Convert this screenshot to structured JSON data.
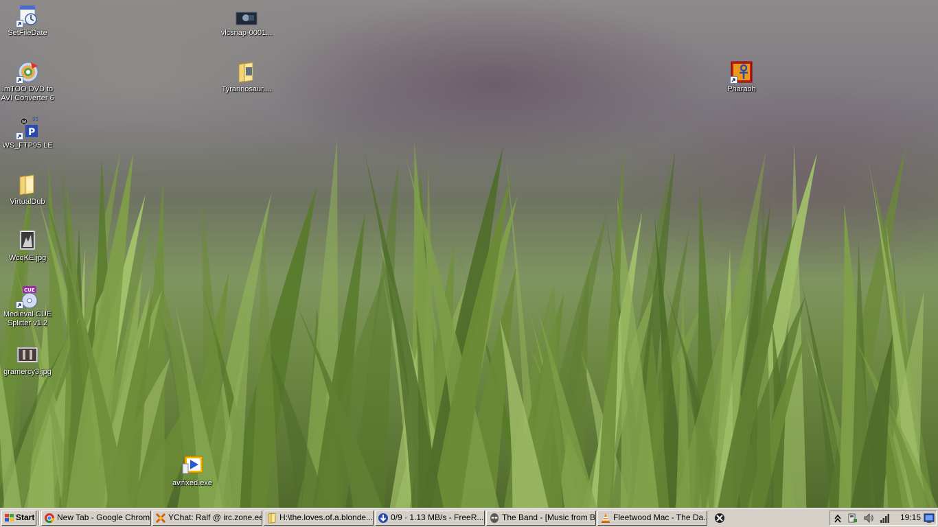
{
  "desktop": {
    "icons": [
      {
        "id": "setfiledate",
        "label": "SetFileDate",
        "icon": "calendar-clock-icon"
      },
      {
        "id": "imtoo",
        "label": "ImTOO DVD to AVI Converter 6",
        "icon": "dvd-converter-icon"
      },
      {
        "id": "wsftp",
        "label": "WS_FTP95 LE",
        "icon": "ftp-client-icon"
      },
      {
        "id": "virtualdub",
        "label": "VirtualDub",
        "icon": "folder-icon"
      },
      {
        "id": "wcqke",
        "label": "WcqKE.jpg",
        "icon": "image-file-icon"
      },
      {
        "id": "cuesplitter",
        "label": "Medieval CUE Splitter v1.2",
        "icon": "cue-splitter-icon"
      },
      {
        "id": "gramercy",
        "label": "gramercy3.jpg",
        "icon": "image-file-icon"
      },
      {
        "id": "avifixed",
        "label": "avifixed.exe",
        "icon": "media-exe-icon"
      },
      {
        "id": "vlcsnap",
        "label": "vlcsnap-0001...",
        "icon": "image-file-icon"
      },
      {
        "id": "tyrannosaur",
        "label": "Tyrannosaur....",
        "icon": "folder-icon"
      },
      {
        "id": "pharaoh",
        "label": "Pharaoh",
        "icon": "pharaoh-ankh-icon"
      }
    ]
  },
  "taskbar": {
    "start_label": "Start",
    "tasks": [
      {
        "label": "New Tab - Google Chrome",
        "icon": "chrome-icon"
      },
      {
        "label": "YChat: Ralf @ irc.zone.ee...",
        "icon": "ychat-icon"
      },
      {
        "label": "H:\\the.loves.of.a.blonde....",
        "icon": "folder-icon"
      },
      {
        "label": "0/9 · 1.13 MB/s - FreeR...",
        "icon": "download-icon"
      },
      {
        "label": "The Band - [Music from Bi...",
        "icon": "alien-player-icon"
      },
      {
        "label": "Fleetwood Mac - The Da...",
        "icon": "vlc-cone-icon"
      }
    ],
    "quicklaunch_icon": "x-app-icon",
    "tray": {
      "icons": [
        "show-hidden-chevron-icon",
        "safely-remove-hardware-icon",
        "volume-icon",
        "network-signal-icon",
        "desktop-icon"
      ],
      "clock": "19:15"
    }
  },
  "colors": {
    "taskbar_bg": "#d4d0c8",
    "label_text": "#ffffff"
  }
}
